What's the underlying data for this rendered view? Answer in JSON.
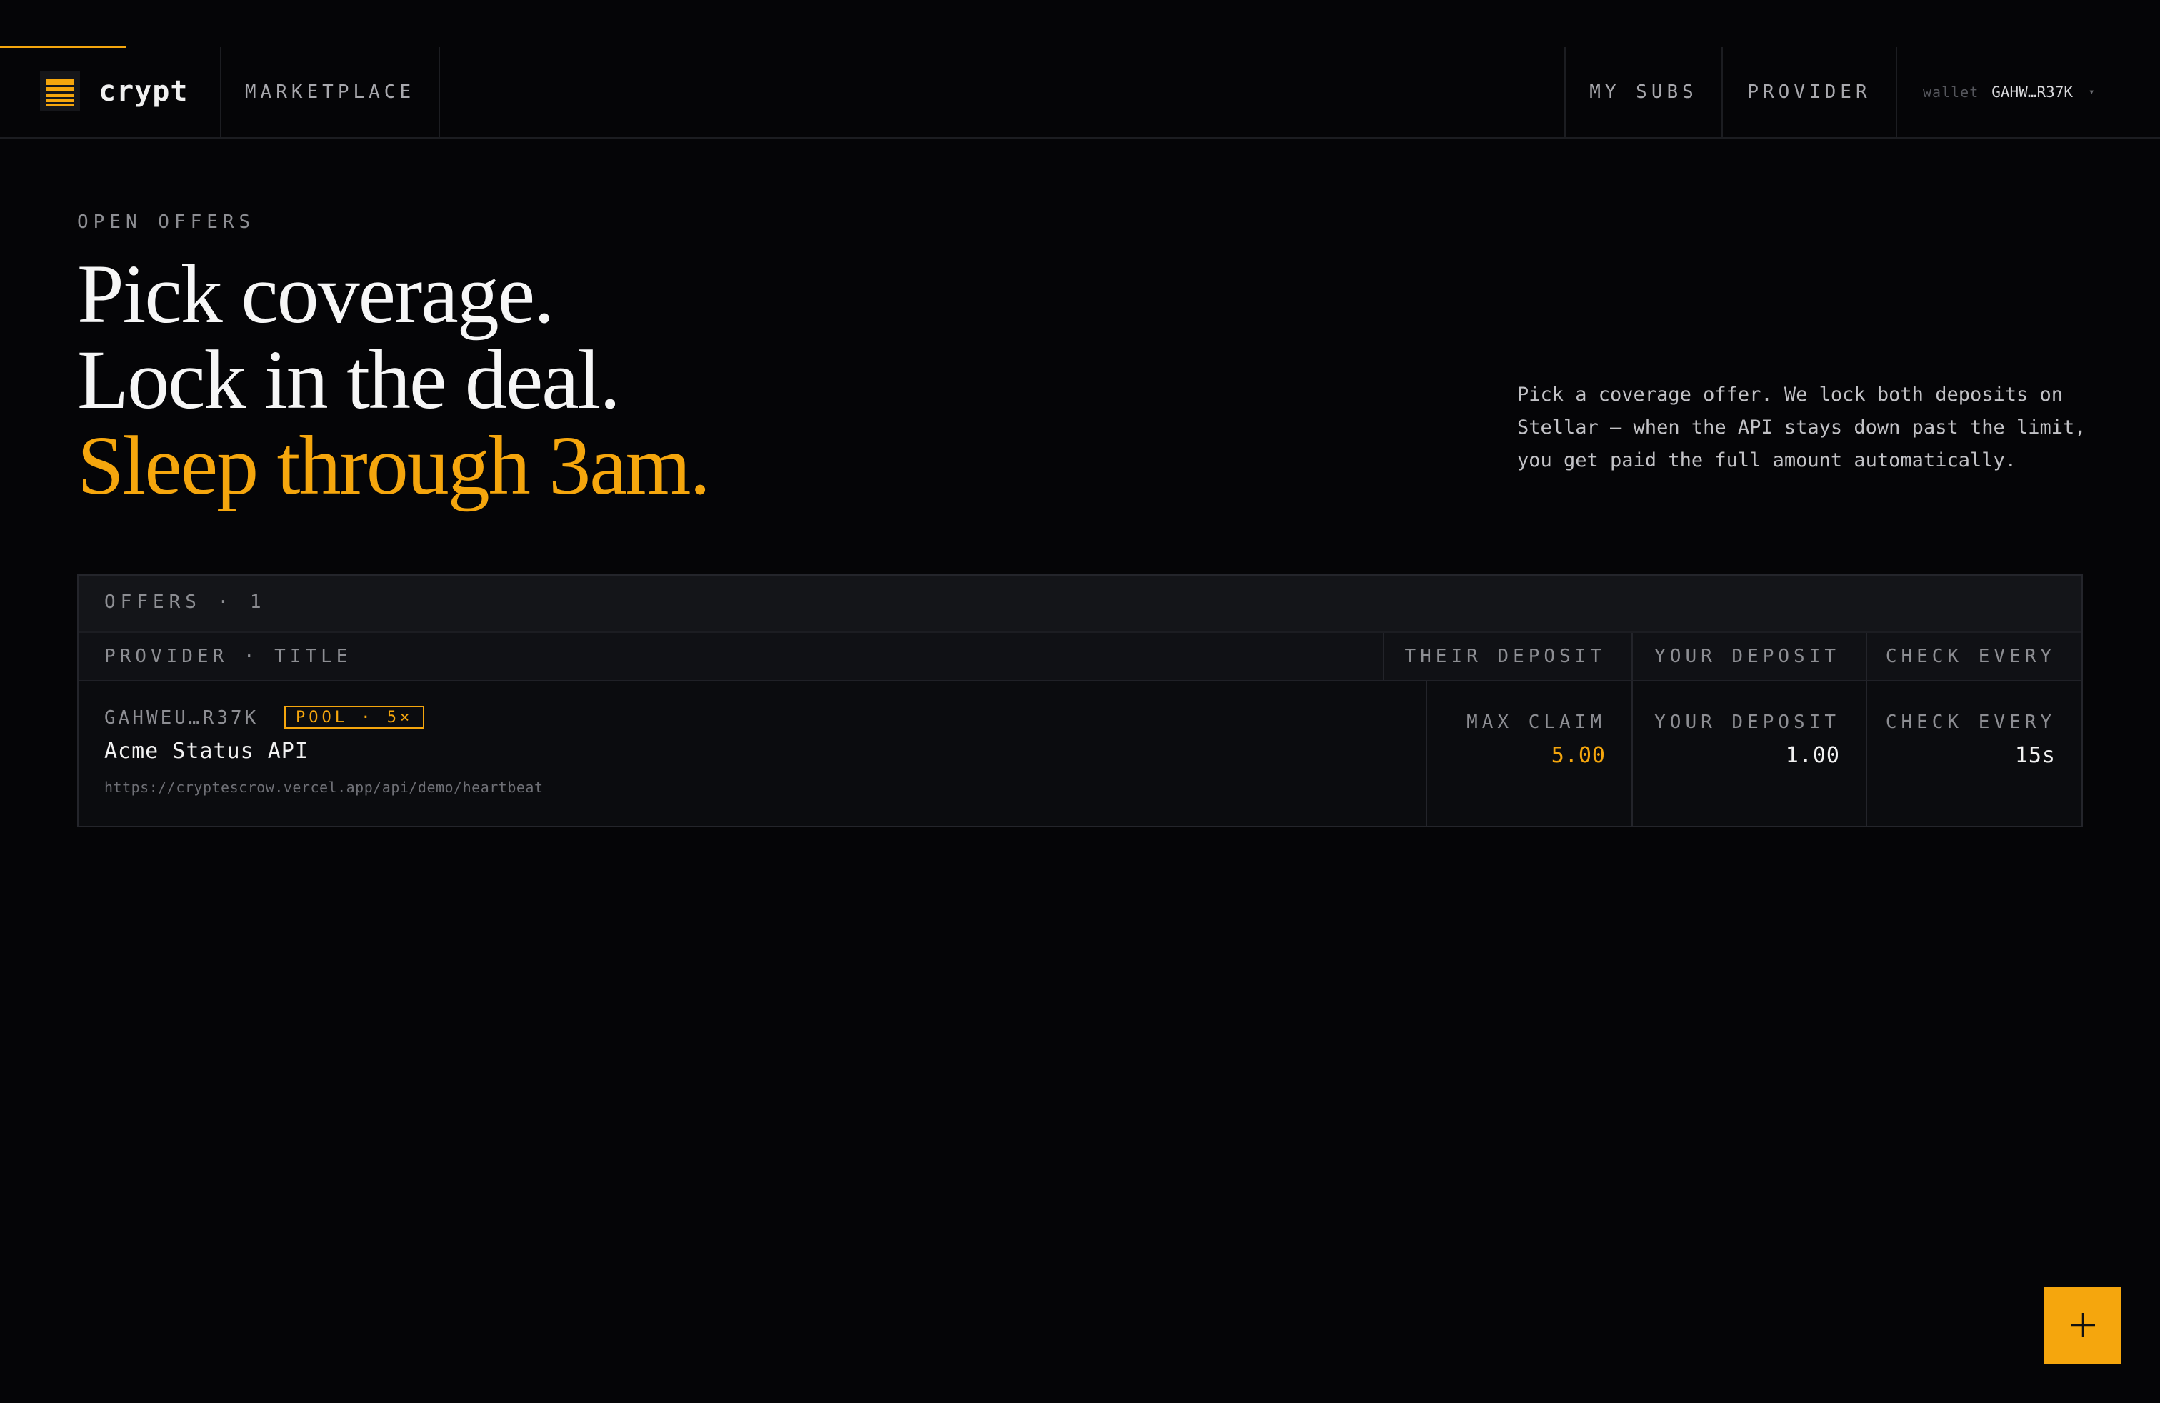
{
  "header": {
    "brand": "crypt",
    "nav": {
      "marketplace": "MARKETPLACE",
      "my_subs": "MY SUBS",
      "provider": "PROVIDER"
    },
    "wallet": {
      "label": "wallet",
      "address": "GAHW…R37K",
      "caret": "▾"
    }
  },
  "hero": {
    "eyebrow": "OPEN OFFERS",
    "headline_lines": [
      "Pick coverage.",
      "Lock in the deal.",
      "Sleep through 3am."
    ],
    "description": "Pick a coverage offer. We lock both deposits on Stellar — when the API stays down past the limit, you get paid the full amount automatically."
  },
  "offers": {
    "count_label": "OFFERS · 1",
    "columns": {
      "provider_title": "PROVIDER · TITLE",
      "their_deposit": "THEIR DEPOSIT",
      "your_deposit": "YOUR DEPOSIT",
      "check_every": "CHECK EVERY"
    },
    "rows": [
      {
        "provider": "GAHWEU…R37K",
        "badge": "POOL · 5×",
        "title": "Acme Status API",
        "url": "https://cryptescrow.vercel.app/api/demo/heartbeat",
        "max_claim_label": "MAX CLAIM",
        "max_claim": "5.00",
        "your_deposit_label": "YOUR DEPOSIT",
        "your_deposit": "1.00",
        "check_every_label": "CHECK EVERY",
        "check_every": "15s"
      }
    ]
  },
  "fab": {
    "icon": "plus-icon"
  },
  "colors": {
    "background": "#050507",
    "accent": "#f5a60d",
    "text": "#f2f2f2",
    "muted": "#8d8e93"
  }
}
